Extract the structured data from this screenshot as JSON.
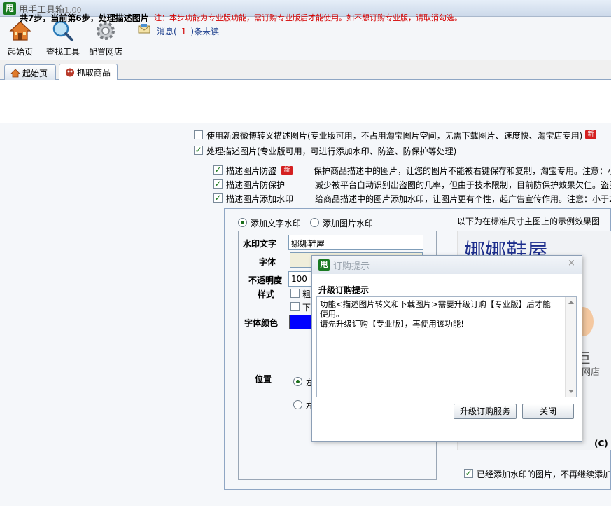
{
  "app": {
    "title": "甩手工具箱",
    "version": "1.00",
    "logo_text": "甩"
  },
  "toolbar": {
    "home_label": "起始页",
    "find_tools_label": "查找工具",
    "config_shop_label": "配置网店",
    "message_prefix": "消息(",
    "message_count": "1",
    "message_suffix": ")条未读"
  },
  "tabs": [
    {
      "label": "起始页",
      "icon": "house-icon",
      "active": false
    },
    {
      "label": "抓取商品",
      "icon": "capture-icon",
      "active": true
    }
  ],
  "step": {
    "title": "共7步，当前第6步，处理描述图片",
    "note": "注：本步功能为专业版功能，需订购专业版后才能使用。如不想订购专业版，请取消勾选。"
  },
  "options": {
    "weibo_label": "使用新浪微博转义描述图片(专业版可用，不占用淘宝图片空间，无需下载图片、速度快、淘宝店专用)",
    "weibo_checked": false,
    "process_label": "处理描述图片(专业版可用，可进行添加水印、防盗、防保护等处理)",
    "process_checked": true,
    "new_tag": "新",
    "sub": [
      {
        "label": "描述图片防盗",
        "checked": true,
        "new": true,
        "desc": "保护商品描述中的图片，让您的图片不能被右键保存和复制，淘宝专用。注意：小于"
      },
      {
        "label": "描述图片防保护",
        "checked": true,
        "new": false,
        "desc": "减少被平台自动识别出盗图的几率，但由于技术限制，目前防保护效果欠佳。盗图"
      },
      {
        "label": "描述图片添加水印",
        "checked": true,
        "new": false,
        "desc": "给商品描述中的图片添加水印，让图片更有个性，起广告宣传作用。注意：小于2"
      }
    ]
  },
  "watermark": {
    "text_wm_label": "添加文字水印",
    "image_wm_label": "添加图片水印",
    "text_label": "水印文字",
    "text_value": "娜娜鞋屋",
    "font_label": "字体",
    "opacity_label": "不透明度",
    "opacity_value": "100",
    "style_label": "样式",
    "style_bold_label": "粗",
    "style_underline_label": "下",
    "color_label": "字体颜色",
    "font_color": "#0000ff",
    "position_label": "位置",
    "pos1_label": "左",
    "pos2_label": "左",
    "preview_caption": "以下为在标准尺寸主图上的示例效果图",
    "preview_watermark": "娜娜鞋屋",
    "preview_text_1": "巨",
    "preview_text_2": "牙网店",
    "preview_copyright": "(C) s",
    "skip_label": "已经添加水印的图片，不再继续添加"
  },
  "dialog": {
    "title": "订购提示",
    "heading": "升级订购提示",
    "message_lines": [
      "功能<描述图片转义和下载图片>需要升级订购【专业版】后才能",
      "使用。",
      "请先升级订购【专业版】，再使用该功能!"
    ],
    "upgrade_button": "升级订购服务",
    "close_button": "关闭"
  }
}
